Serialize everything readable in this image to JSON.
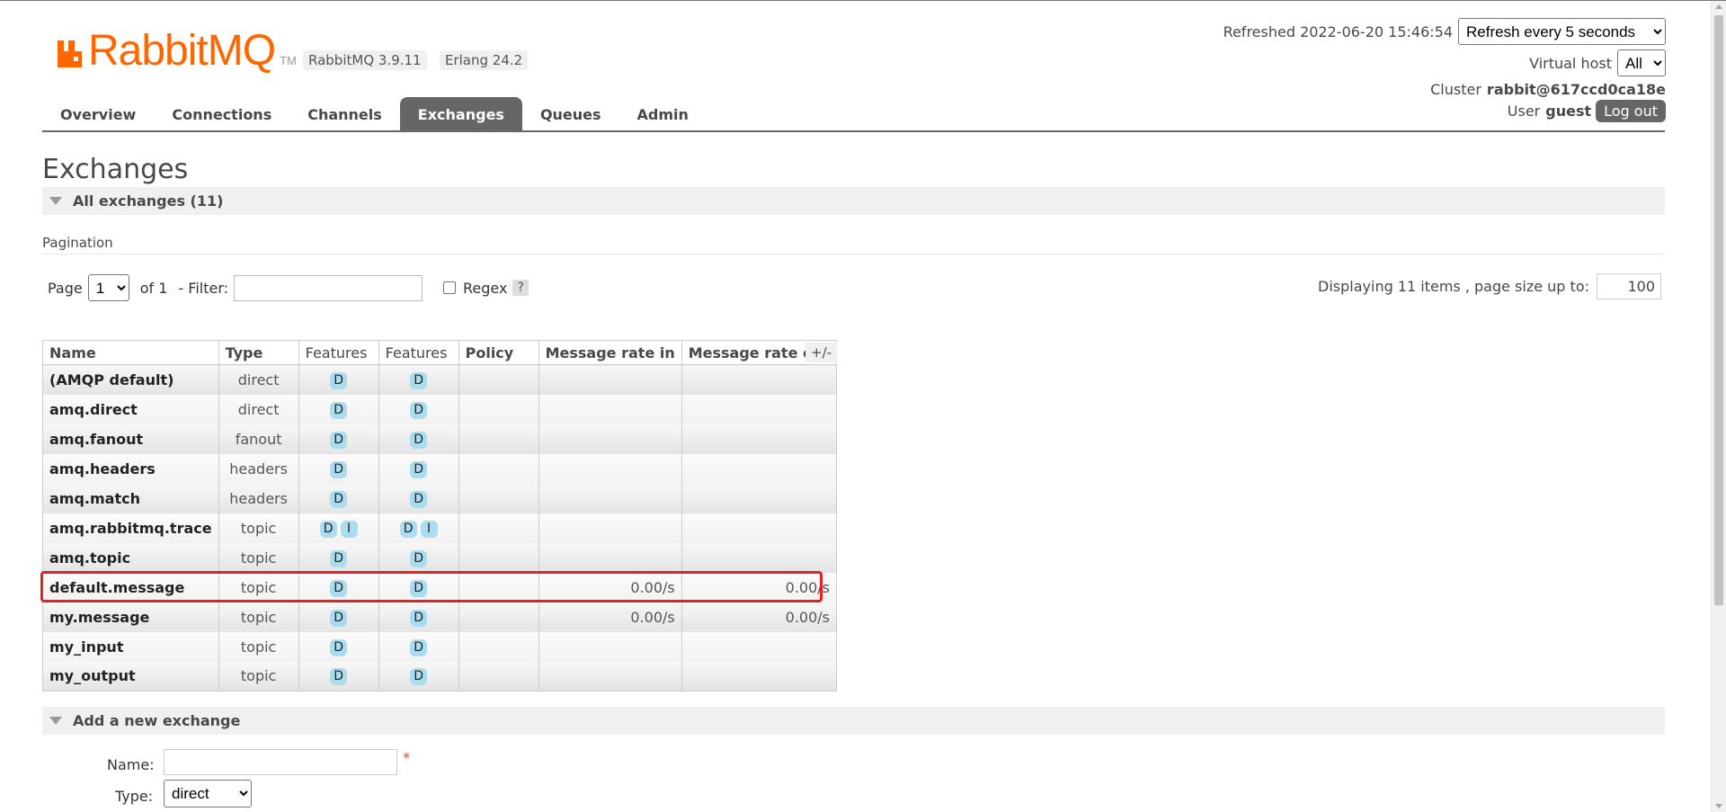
{
  "header": {
    "logo_text": "RabbitMQ",
    "logo_tm": "TM",
    "rabbitmq_version": "RabbitMQ 3.9.11",
    "erlang_version": "Erlang 24.2",
    "refreshed_label": "Refreshed 2022-06-20 15:46:54",
    "refresh_select_value": "Refresh every 5 seconds",
    "virtual_host_label": "Virtual host",
    "virtual_host_value": "All",
    "cluster_label": "Cluster",
    "cluster_value": "rabbit@617ccd0ca18e",
    "user_label": "User",
    "user_value": "guest",
    "logout_label": "Log out",
    "brand_color": "#ff6600"
  },
  "tabs": [
    {
      "label": "Overview",
      "active": false
    },
    {
      "label": "Connections",
      "active": false
    },
    {
      "label": "Channels",
      "active": false
    },
    {
      "label": "Exchanges",
      "active": true
    },
    {
      "label": "Queues",
      "active": false
    },
    {
      "label": "Admin",
      "active": false
    }
  ],
  "page_title": "Exchanges",
  "all_exchanges_label": "All exchanges (11)",
  "pagination": {
    "section_label": "Pagination",
    "page_label": "Page",
    "page_value": "1",
    "of_label": "of 1",
    "filter_label": "- Filter:",
    "filter_value": "",
    "regex_label": "Regex",
    "regex_checked": false,
    "help_label": "?",
    "display_label": "Displaying 11 items , page size up to:",
    "page_size": "100"
  },
  "table": {
    "columns": [
      "Name",
      "Type",
      "Features",
      "Features",
      "Policy",
      "Message rate in",
      "Message rate out"
    ],
    "toggle_label": "+/-",
    "rows": [
      {
        "name": "(AMQP default)",
        "type": "direct",
        "features_a": [
          "D"
        ],
        "features_b": [
          "D"
        ],
        "policy": "",
        "rate_in": "",
        "rate_out": ""
      },
      {
        "name": "amq.direct",
        "type": "direct",
        "features_a": [
          "D"
        ],
        "features_b": [
          "D"
        ],
        "policy": "",
        "rate_in": "",
        "rate_out": ""
      },
      {
        "name": "amq.fanout",
        "type": "fanout",
        "features_a": [
          "D"
        ],
        "features_b": [
          "D"
        ],
        "policy": "",
        "rate_in": "",
        "rate_out": ""
      },
      {
        "name": "amq.headers",
        "type": "headers",
        "features_a": [
          "D"
        ],
        "features_b": [
          "D"
        ],
        "policy": "",
        "rate_in": "",
        "rate_out": ""
      },
      {
        "name": "amq.match",
        "type": "headers",
        "features_a": [
          "D"
        ],
        "features_b": [
          "D"
        ],
        "policy": "",
        "rate_in": "",
        "rate_out": ""
      },
      {
        "name": "amq.rabbitmq.trace",
        "type": "topic",
        "features_a": [
          "D",
          "I"
        ],
        "features_b": [
          "D",
          "I"
        ],
        "policy": "",
        "rate_in": "",
        "rate_out": ""
      },
      {
        "name": "amq.topic",
        "type": "topic",
        "features_a": [
          "D"
        ],
        "features_b": [
          "D"
        ],
        "policy": "",
        "rate_in": "",
        "rate_out": ""
      },
      {
        "name": "default.message",
        "type": "topic",
        "features_a": [
          "D"
        ],
        "features_b": [
          "D"
        ],
        "policy": "",
        "rate_in": "0.00/s",
        "rate_out": "0.00/s",
        "highlighted": true
      },
      {
        "name": "my.message",
        "type": "topic",
        "features_a": [
          "D"
        ],
        "features_b": [
          "D"
        ],
        "policy": "",
        "rate_in": "0.00/s",
        "rate_out": "0.00/s"
      },
      {
        "name": "my_input",
        "type": "topic",
        "features_a": [
          "D"
        ],
        "features_b": [
          "D"
        ],
        "policy": "",
        "rate_in": "",
        "rate_out": ""
      },
      {
        "name": "my_output",
        "type": "topic",
        "features_a": [
          "D"
        ],
        "features_b": [
          "D"
        ],
        "policy": "",
        "rate_in": "",
        "rate_out": ""
      }
    ],
    "highlight_color": "#e42222"
  },
  "add_exchange": {
    "section_label": "Add a new exchange",
    "name_label": "Name:",
    "name_value": "",
    "required_mark": "*",
    "type_label": "Type:",
    "type_value": "direct"
  }
}
